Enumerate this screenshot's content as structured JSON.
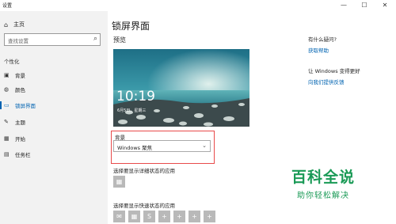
{
  "window": {
    "title": "设置",
    "minimize": "—",
    "maximize": "☐",
    "close": "✕"
  },
  "sidebar": {
    "home_label": "主页",
    "search_placeholder": "查找设置",
    "section_label": "个性化",
    "items": [
      {
        "label": "背景",
        "icon": "picture-icon"
      },
      {
        "label": "颜色",
        "icon": "palette-icon"
      },
      {
        "label": "锁屏界面",
        "icon": "lock-screen-icon",
        "active": true
      },
      {
        "label": "主题",
        "icon": "brush-icon"
      },
      {
        "label": "开始",
        "icon": "start-icon"
      },
      {
        "label": "任务栏",
        "icon": "taskbar-icon"
      }
    ]
  },
  "main": {
    "page_title": "锁屏界面",
    "preview_label": "预览",
    "lock_time": "10:19",
    "lock_date": "6月5日，星期三",
    "background_label": "背景",
    "background_value": "Windows 聚焦",
    "detailed_status_label": "选择要显示详细状态的应用",
    "quick_status_label": "选择要显示快速状态的应用",
    "quick_status_icons": [
      "mail-icon",
      "calendar-icon",
      "skype-icon",
      "plus-icon",
      "plus-icon",
      "plus-icon",
      "plus-icon"
    ]
  },
  "help": {
    "question": "有什么疑问?",
    "question_link": "获取帮助",
    "improve": "让 Windows 变得更好",
    "improve_link": "向我们提供反馈"
  },
  "watermark": {
    "title": "百科全说",
    "subtitle": "助你轻松解决"
  },
  "colors": {
    "accent": "#0063b1",
    "highlight_box": "#e84a4a",
    "watermark": "#1a9a56"
  }
}
